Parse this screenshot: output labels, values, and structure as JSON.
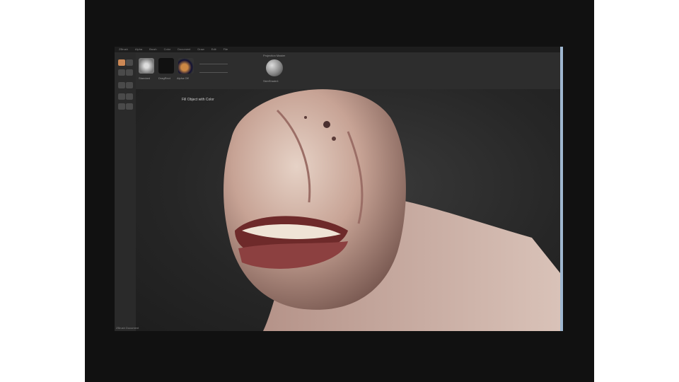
{
  "menubar": {
    "items": [
      "ZBrush",
      "Alpha",
      "Brush",
      "Color",
      "Document",
      "Draw",
      "Edit",
      "File",
      "Layer",
      "Light",
      "Macro",
      "Marker",
      "Material",
      "Movie",
      "Picker",
      "Preferences",
      "Render",
      "Stencil",
      "Stroke",
      "Texture",
      "Tool",
      "Transform",
      "Zplugin",
      "Zscript"
    ]
  },
  "toolbar": {
    "brush_label": "Standard",
    "stroke_label": "DragRect",
    "alpha_label": "Alpha Off",
    "material_label": "SkinShade4",
    "section_label": "Projection Master",
    "notice": "Fill Object with Color"
  },
  "status_text": "ZBrush Document",
  "colors": {
    "accent": "#9fb7d0",
    "background": "#262626"
  },
  "model": {
    "name": "creature-head",
    "icon": "sculpt-mesh"
  }
}
